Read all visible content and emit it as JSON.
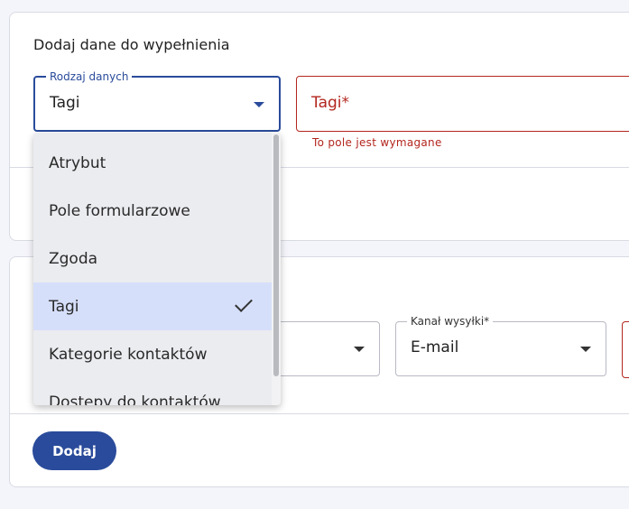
{
  "card1": {
    "title": "Dodaj dane do wypełnienia",
    "data_type_field": {
      "label": "Rodzaj danych",
      "value": "Tagi"
    },
    "tags_field": {
      "placeholder": "Tagi",
      "required_mark": "*",
      "error": "To pole jest wymagane"
    }
  },
  "card2": {
    "channel_field": {
      "label": "Kanał wysyłki*",
      "value": "E-mail"
    },
    "add_button": "Dodaj"
  },
  "dropdown": {
    "items": [
      {
        "label": "Atrybut"
      },
      {
        "label": "Pole formularzowe"
      },
      {
        "label": "Zgoda"
      },
      {
        "label": "Tagi",
        "selected": true
      },
      {
        "label": "Kategorie kontaktów"
      },
      {
        "label": "Dostępy do kontaktów"
      }
    ]
  },
  "colors": {
    "primary": "#2a4b9b",
    "error": "#b3261e",
    "selected_bg": "#d6dffa"
  }
}
